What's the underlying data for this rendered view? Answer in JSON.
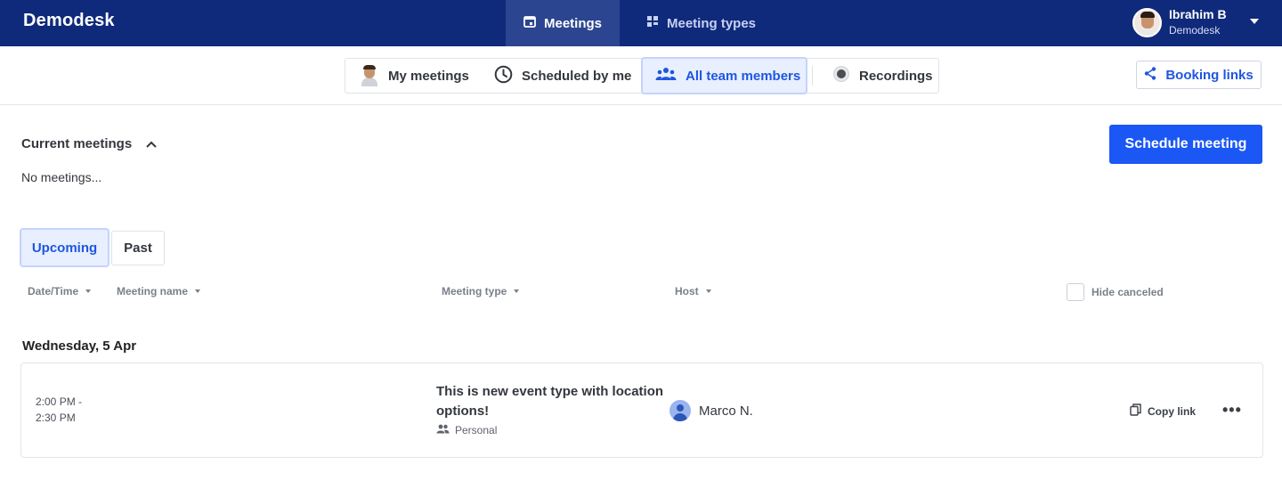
{
  "brand": {
    "logo_text": "Demodesk"
  },
  "topnav": {
    "tabs": [
      {
        "label": "Meetings",
        "icon": "calendar-icon",
        "active": true
      },
      {
        "label": "Meeting types",
        "icon": "grid-icon",
        "active": false
      }
    ],
    "user": {
      "name": "Ibrahim B",
      "org": "Demodesk"
    }
  },
  "filters": {
    "items": [
      {
        "label": "My meetings",
        "icon": "user-avatar-icon"
      },
      {
        "label": "Scheduled by me",
        "icon": "clock-icon"
      },
      {
        "label": "All team members",
        "icon": "team-icon",
        "active": true
      },
      {
        "label": "Recordings",
        "icon": "record-icon"
      }
    ],
    "booking_links": "Booking links"
  },
  "current": {
    "title": "Current meetings",
    "empty": "No meetings...",
    "schedule_button": "Schedule meeting"
  },
  "tabs": {
    "upcoming": "Upcoming",
    "past": "Past"
  },
  "columns": {
    "datetime": "Date/Time",
    "name": "Meeting name",
    "type": "Meeting type",
    "host": "Host",
    "hide_canceled": "Hide canceled"
  },
  "day": {
    "label": "Wednesday, 5 Apr"
  },
  "meeting": {
    "time_start": "2:00 PM -",
    "time_end": "2:30 PM",
    "name": "This is new event type with location options!",
    "type": "Personal",
    "host": "Marco N.",
    "copy_link": "Copy link",
    "more": "•••"
  },
  "colors": {
    "nav_bg": "#0f2a7a",
    "accent": "#1b57f5",
    "active_bg": "#e8efff"
  }
}
